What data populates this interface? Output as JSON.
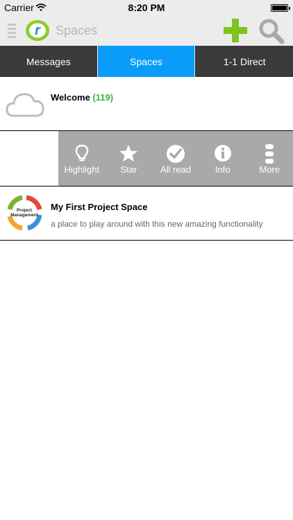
{
  "status_bar": {
    "carrier": "Carrier",
    "time": "8:20 PM"
  },
  "nav": {
    "title": "Spaces",
    "menu_icon": "menu-icon",
    "logo_letter": "r"
  },
  "tabs": [
    {
      "label": "Messages",
      "active": false
    },
    {
      "label": "Spaces",
      "active": true
    },
    {
      "label": "1-1 Direct",
      "active": false
    }
  ],
  "spaces": [
    {
      "title": "Welcome",
      "count": "(119)",
      "icon": "cloud-icon"
    },
    {
      "title": "My First Project Space",
      "subtitle": "a place to play around with this new amazing functionality",
      "icon": "project-management-thumbnail",
      "thumb_label_1": "Project",
      "thumb_label_2": "Management"
    }
  ],
  "swipe_actions": [
    {
      "label": "Highlight",
      "icon": "lightbulb-icon"
    },
    {
      "label": "Star",
      "icon": "star-icon"
    },
    {
      "label": "All read",
      "icon": "checkmark-circle-icon"
    },
    {
      "label": "Info",
      "icon": "info-icon"
    },
    {
      "label": "More",
      "icon": "more-dots-icon"
    }
  ],
  "colors": {
    "active_tab": "#0a9cfa",
    "tab_bar": "#3a3a3a",
    "add_button": "#7cc51e",
    "count_text": "#3cb53a",
    "action_tray": "#a9a9a9"
  }
}
